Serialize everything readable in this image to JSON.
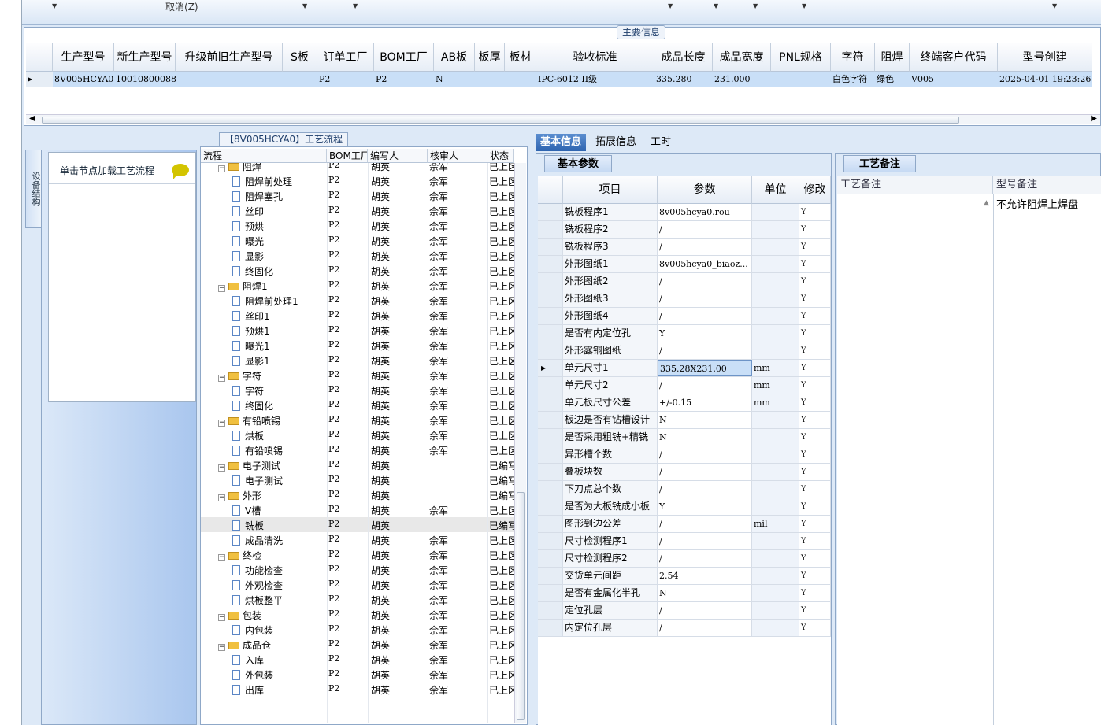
{
  "toolbar": {
    "cancel_label": "取消(Z)"
  },
  "main_panel": {
    "title": "主要信息",
    "columns": [
      "生产型号",
      "新生产型号",
      "升级前旧生产型号",
      "S板",
      "订单工厂",
      "BOM工厂",
      "AB板",
      "板厚",
      "板材",
      "验收标准",
      "成品长度",
      "成品宽度",
      "PNL规格",
      "字符",
      "阻焊",
      "终端客户代码",
      "型号创建"
    ],
    "row": [
      "8V005HCYA0",
      "10010800088484",
      "",
      "",
      "P2",
      "P2",
      "N",
      "",
      "",
      "IPC-6012 II级",
      "335.280",
      "231.000",
      "",
      "白色字符",
      "绿色",
      "V005",
      "2025-04-01 19:23:26"
    ]
  },
  "sidebar": {
    "tab_label": "设备结构",
    "hint": "单击节点加载工艺流程"
  },
  "tree": {
    "title": "【8V005HCYA0】工艺流程",
    "columns": [
      "流程",
      "BOM工厂",
      "编写人",
      "核审人",
      "状态"
    ],
    "rows": [
      {
        "name": "阻焊",
        "level": 0,
        "folder": true,
        "p": "P2",
        "w": "胡英",
        "r": "佘军",
        "s": "已上区"
      },
      {
        "name": "阻焊前处理",
        "level": 1,
        "p": "P2",
        "w": "胡英",
        "r": "佘军",
        "s": "已上区"
      },
      {
        "name": "阻焊塞孔",
        "level": 1,
        "p": "P2",
        "w": "胡英",
        "r": "佘军",
        "s": "已上区"
      },
      {
        "name": "丝印",
        "level": 1,
        "p": "P2",
        "w": "胡英",
        "r": "佘军",
        "s": "已上区"
      },
      {
        "name": "预烘",
        "level": 1,
        "p": "P2",
        "w": "胡英",
        "r": "佘军",
        "s": "已上区"
      },
      {
        "name": "曝光",
        "level": 1,
        "p": "P2",
        "w": "胡英",
        "r": "佘军",
        "s": "已上区"
      },
      {
        "name": "显影",
        "level": 1,
        "p": "P2",
        "w": "胡英",
        "r": "佘军",
        "s": "已上区"
      },
      {
        "name": "终固化",
        "level": 1,
        "p": "P2",
        "w": "胡英",
        "r": "佘军",
        "s": "已上区"
      },
      {
        "name": "阻焊1",
        "level": 0,
        "folder": true,
        "p": "P2",
        "w": "胡英",
        "r": "佘军",
        "s": "已上区"
      },
      {
        "name": "阻焊前处理1",
        "level": 1,
        "p": "P2",
        "w": "胡英",
        "r": "佘军",
        "s": "已上区"
      },
      {
        "name": "丝印1",
        "level": 1,
        "p": "P2",
        "w": "胡英",
        "r": "佘军",
        "s": "已上区"
      },
      {
        "name": "预烘1",
        "level": 1,
        "p": "P2",
        "w": "胡英",
        "r": "佘军",
        "s": "已上区"
      },
      {
        "name": "曝光1",
        "level": 1,
        "p": "P2",
        "w": "胡英",
        "r": "佘军",
        "s": "已上区"
      },
      {
        "name": "显影1",
        "level": 1,
        "p": "P2",
        "w": "胡英",
        "r": "佘军",
        "s": "已上区"
      },
      {
        "name": "字符",
        "level": 0,
        "folder": true,
        "p": "P2",
        "w": "胡英",
        "r": "佘军",
        "s": "已上区"
      },
      {
        "name": "字符",
        "level": 1,
        "p": "P2",
        "w": "胡英",
        "r": "佘军",
        "s": "已上区"
      },
      {
        "name": "终固化",
        "level": 1,
        "p": "P2",
        "w": "胡英",
        "r": "佘军",
        "s": "已上区"
      },
      {
        "name": "有铅喷锡",
        "level": 0,
        "folder": true,
        "p": "P2",
        "w": "胡英",
        "r": "佘军",
        "s": "已上区"
      },
      {
        "name": "烘板",
        "level": 1,
        "p": "P2",
        "w": "胡英",
        "r": "佘军",
        "s": "已上区"
      },
      {
        "name": "有铅喷锡",
        "level": 1,
        "p": "P2",
        "w": "胡英",
        "r": "佘军",
        "s": "已上区"
      },
      {
        "name": "电子测试",
        "level": 0,
        "folder": true,
        "p": "P2",
        "w": "胡英",
        "r": "",
        "s": "已编写"
      },
      {
        "name": "电子测试",
        "level": 1,
        "p": "P2",
        "w": "胡英",
        "r": "",
        "s": "已编写"
      },
      {
        "name": "外形",
        "level": 0,
        "folder": true,
        "p": "P2",
        "w": "胡英",
        "r": "",
        "s": "已编写"
      },
      {
        "name": "V槽",
        "level": 1,
        "p": "P2",
        "w": "胡英",
        "r": "佘军",
        "s": "已上区"
      },
      {
        "name": "铣板",
        "level": 1,
        "p": "P2",
        "w": "胡英",
        "r": "",
        "s": "已编写",
        "selected": true
      },
      {
        "name": "成品清洗",
        "level": 1,
        "p": "P2",
        "w": "胡英",
        "r": "佘军",
        "s": "已上区"
      },
      {
        "name": "终检",
        "level": 0,
        "folder": true,
        "p": "P2",
        "w": "胡英",
        "r": "佘军",
        "s": "已上区"
      },
      {
        "name": "功能检查",
        "level": 1,
        "p": "P2",
        "w": "胡英",
        "r": "佘军",
        "s": "已上区"
      },
      {
        "name": "外观检查",
        "level": 1,
        "p": "P2",
        "w": "胡英",
        "r": "佘军",
        "s": "已上区"
      },
      {
        "name": "烘板整平",
        "level": 1,
        "p": "P2",
        "w": "胡英",
        "r": "佘军",
        "s": "已上区"
      },
      {
        "name": "包装",
        "level": 0,
        "folder": true,
        "p": "P2",
        "w": "胡英",
        "r": "佘军",
        "s": "已上区"
      },
      {
        "name": "内包装",
        "level": 1,
        "p": "P2",
        "w": "胡英",
        "r": "佘军",
        "s": "已上区"
      },
      {
        "name": "成品仓",
        "level": 0,
        "folder": true,
        "p": "P2",
        "w": "胡英",
        "r": "佘军",
        "s": "已上区"
      },
      {
        "name": "入库",
        "level": 1,
        "p": "P2",
        "w": "胡英",
        "r": "佘军",
        "s": "已上区"
      },
      {
        "name": "外包装",
        "level": 1,
        "p": "P2",
        "w": "胡英",
        "r": "佘军",
        "s": "已上区"
      },
      {
        "name": "出库",
        "level": 1,
        "p": "P2",
        "w": "胡英",
        "r": "佘军",
        "s": "已上区"
      }
    ]
  },
  "tabs": [
    "基本信息",
    "拓展信息",
    "工时"
  ],
  "basic": {
    "subtab": "基本参数",
    "columns": [
      "项目",
      "参数",
      "单位",
      "修改"
    ],
    "rows": [
      {
        "n": "铣板程序1",
        "v": "8v005hcya0.rou",
        "u": "",
        "m": "Y"
      },
      {
        "n": "铣板程序2",
        "v": "/",
        "u": "",
        "m": "Y"
      },
      {
        "n": "铣板程序3",
        "v": "/",
        "u": "",
        "m": "Y"
      },
      {
        "n": "外形图纸1",
        "v": "8v005hcya0_biaoz...",
        "u": "",
        "m": "Y"
      },
      {
        "n": "外形图纸2",
        "v": "/",
        "u": "",
        "m": "Y"
      },
      {
        "n": "外形图纸3",
        "v": "/",
        "u": "",
        "m": "Y"
      },
      {
        "n": "外形图纸4",
        "v": "/",
        "u": "",
        "m": "Y"
      },
      {
        "n": "是否有内定位孔",
        "v": "Y",
        "u": "",
        "m": "Y"
      },
      {
        "n": "外形露铜图纸",
        "v": "/",
        "u": "",
        "m": "Y"
      },
      {
        "n": "单元尺寸1",
        "v": "335.28X231.00",
        "u": "mm",
        "m": "Y",
        "sel": true
      },
      {
        "n": "单元尺寸2",
        "v": "/",
        "u": "mm",
        "m": "Y"
      },
      {
        "n": "单元板尺寸公差",
        "v": "+/-0.15",
        "u": "mm",
        "m": "Y"
      },
      {
        "n": "板边是否有钻槽设计",
        "v": "N",
        "u": "",
        "m": "Y"
      },
      {
        "n": "是否采用粗铣+精铣",
        "v": "N",
        "u": "",
        "m": "Y"
      },
      {
        "n": "异形槽个数",
        "v": "/",
        "u": "",
        "m": "Y"
      },
      {
        "n": "叠板块数",
        "v": "/",
        "u": "",
        "m": "Y"
      },
      {
        "n": "下刀点总个数",
        "v": "/",
        "u": "",
        "m": "Y"
      },
      {
        "n": "是否为大板铣成小板",
        "v": "Y",
        "u": "",
        "m": "Y"
      },
      {
        "n": "图形到边公差",
        "v": "/",
        "u": "mil",
        "m": "Y"
      },
      {
        "n": "尺寸检测程序1",
        "v": "/",
        "u": "",
        "m": "Y"
      },
      {
        "n": "尺寸检测程序2",
        "v": "/",
        "u": "",
        "m": "Y"
      },
      {
        "n": "交货单元间距",
        "v": "2.54",
        "u": "",
        "m": "Y"
      },
      {
        "n": "是否有金属化半孔",
        "v": "N",
        "u": "",
        "m": "Y"
      },
      {
        "n": "定位孔层",
        "v": "/",
        "u": "",
        "m": "Y"
      },
      {
        "n": "内定位孔层",
        "v": "/",
        "u": "",
        "m": "Y"
      }
    ]
  },
  "notes": {
    "subtab": "工艺备注",
    "col1": "工艺备注",
    "col2": "型号备注",
    "note2": "不允许阻焊上焊盘"
  }
}
